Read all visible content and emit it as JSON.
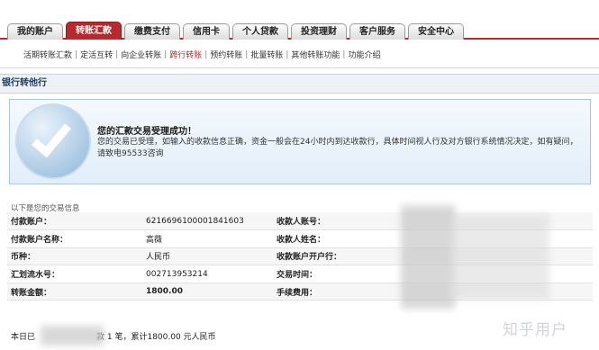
{
  "tabs": [
    {
      "label": "我的账户",
      "active": false
    },
    {
      "label": "转账汇款",
      "active": true
    },
    {
      "label": "缴费支付",
      "active": false
    },
    {
      "label": "信用卡",
      "active": false
    },
    {
      "label": "个人贷款",
      "active": false
    },
    {
      "label": "投资理财",
      "active": false
    },
    {
      "label": "客户服务",
      "active": false
    },
    {
      "label": "安全中心",
      "active": false
    }
  ],
  "subnav": [
    {
      "label": "活期转账汇款",
      "active": false
    },
    {
      "label": "定活互转",
      "active": false
    },
    {
      "label": "向企业转账",
      "active": false
    },
    {
      "label": "跨行转账",
      "active": true
    },
    {
      "label": "预约转账",
      "active": false
    },
    {
      "label": "批量转账",
      "active": false
    },
    {
      "label": "其他转账功能",
      "active": false
    },
    {
      "label": "功能介绍",
      "active": false
    }
  ],
  "section_title": "银行转他行",
  "success": {
    "title": "您的汇款交易受理成功！",
    "body": "您的交易已受理，如输入的收款信息正确，资金一般会在24小时内到达收款行，具体时间视人行及对方银行系统情况决定，如有疑问，请致电95533咨询"
  },
  "info_caption": "以下是您的交易信息",
  "info_rows": [
    {
      "label": "付款账户：",
      "value": "6216696100001841603",
      "label2": "收款人账号：",
      "value2": ""
    },
    {
      "label": "付款账户名称：",
      "value": "高薇",
      "label2": "收款人姓名：",
      "value2": ""
    },
    {
      "label": "币种：",
      "value": "人民币",
      "label2": "收款账户开户行：",
      "value2": ""
    },
    {
      "label": "汇划流水号：",
      "value": "002713953214",
      "label2": "交易时间：",
      "value2": ""
    },
    {
      "label": "转账金额：",
      "value": "1800.00",
      "label2": "手续费用：",
      "value2": ""
    }
  ],
  "summary": {
    "prefix": "本日已",
    "middle": "款 1 笔，累计1800.00 元人民币"
  },
  "watermark": "知乎用户",
  "colors": {
    "accent": "#b8282c",
    "box_border": "#a8c4de"
  }
}
